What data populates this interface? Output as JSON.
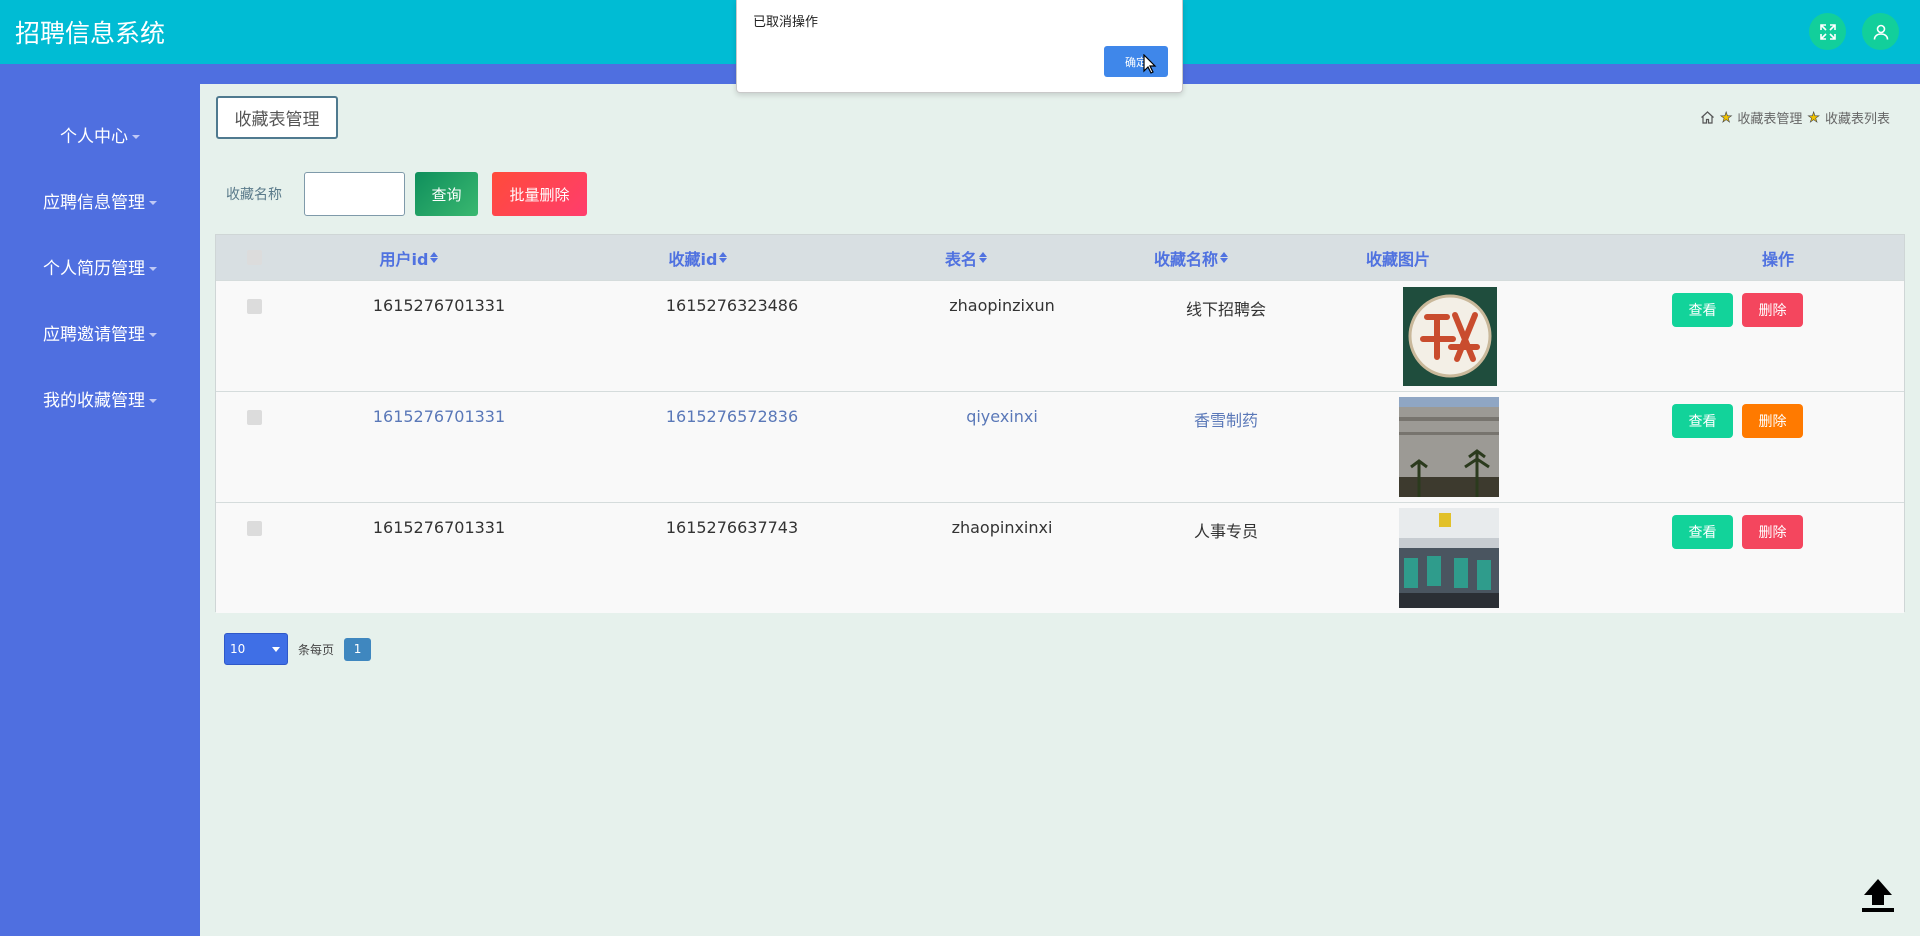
{
  "app": {
    "title": "招聘信息系统"
  },
  "topbar": {
    "fullscreen_icon": "fullscreen-icon",
    "user_icon": "user-icon"
  },
  "sidebar": {
    "items": [
      {
        "label": "个人中心"
      },
      {
        "label": "应聘信息管理"
      },
      {
        "label": "个人简历管理"
      },
      {
        "label": "应聘邀请管理"
      },
      {
        "label": "我的收藏管理"
      }
    ]
  },
  "page": {
    "title": "收藏表管理"
  },
  "breadcrumb": {
    "items": [
      "收藏表管理",
      "收藏表列表"
    ]
  },
  "search": {
    "label": "收藏名称",
    "value": "",
    "query_label": "查询",
    "batch_delete_label": "批量删除"
  },
  "table": {
    "columns": [
      "用户id",
      "收藏id",
      "表名",
      "收藏名称",
      "收藏图片",
      "操作"
    ],
    "rows": [
      {
        "user_id": "1615276701331",
        "fav_id": "1615276323486",
        "table_name": "zhaopinzixun",
        "fav_name": "线下招聘会",
        "image": "招聘-logo",
        "view_label": "查看",
        "delete_label": "删除"
      },
      {
        "user_id": "1615276701331",
        "fav_id": "1615276572836",
        "table_name": "qiyexinxi",
        "fav_name": "香雪制药",
        "image": "building-photo",
        "view_label": "查看",
        "delete_label": "删除"
      },
      {
        "user_id": "1615276701331",
        "fav_id": "1615276637743",
        "table_name": "zhaopinxinxi",
        "fav_name": "人事专员",
        "image": "office-photo",
        "view_label": "查看",
        "delete_label": "删除"
      }
    ]
  },
  "pagination": {
    "page_size": "10",
    "per_page_label": "条每页",
    "current_page": "1"
  },
  "dialog": {
    "message": "已取消操作",
    "ok_label": "确定"
  },
  "colors": {
    "topbar": "#00bcd4",
    "sidebar": "#4f6fe0",
    "accent_green": "#12d39a",
    "delete_red": "#f4465e",
    "delete_orange": "#ff7a00"
  }
}
